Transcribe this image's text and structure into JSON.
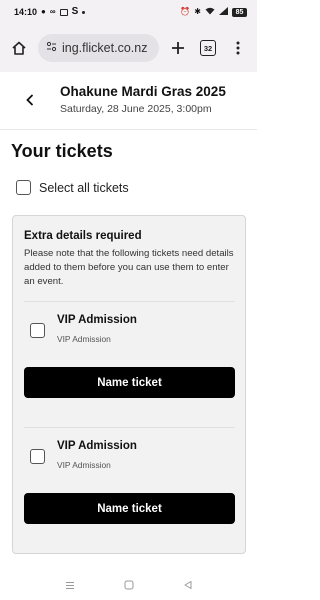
{
  "status_bar": {
    "time": "14:10",
    "left_icons": [
      "message-icon",
      "voicemail-icon",
      "gmail-icon",
      "s-app-icon",
      "dot-icon"
    ],
    "right_icons": [
      "alarm-icon",
      "bluetooth-icon",
      "wifi-icon",
      "signal-icon"
    ],
    "battery": "85"
  },
  "browser": {
    "url": "ing.flicket.co.nz",
    "tab_count": "32",
    "icons": [
      "home-icon",
      "site-settings-icon",
      "new-tab-plus-icon",
      "tab-switcher-icon",
      "more-menu-icon"
    ]
  },
  "event": {
    "title": "Ohakune Mardi Gras 2025",
    "date": "Saturday, 28 June 2025, 3:00pm"
  },
  "page": {
    "heading": "Your tickets",
    "select_all_label": "Select all tickets"
  },
  "extra_details": {
    "title": "Extra details required",
    "description": "Please note that the following tickets need details added to them before you can use them to enter an event.",
    "tickets": [
      {
        "name": "VIP Admission",
        "type": "VIP Admission",
        "button_label": "Name ticket"
      },
      {
        "name": "VIP Admission",
        "type": "VIP Admission",
        "button_label": "Name ticket"
      }
    ]
  },
  "colors": {
    "button_bg": "#000000",
    "button_text": "#ffffff",
    "card_bg": "#f2f2f2",
    "chrome_bg": "#f3f1f4"
  }
}
